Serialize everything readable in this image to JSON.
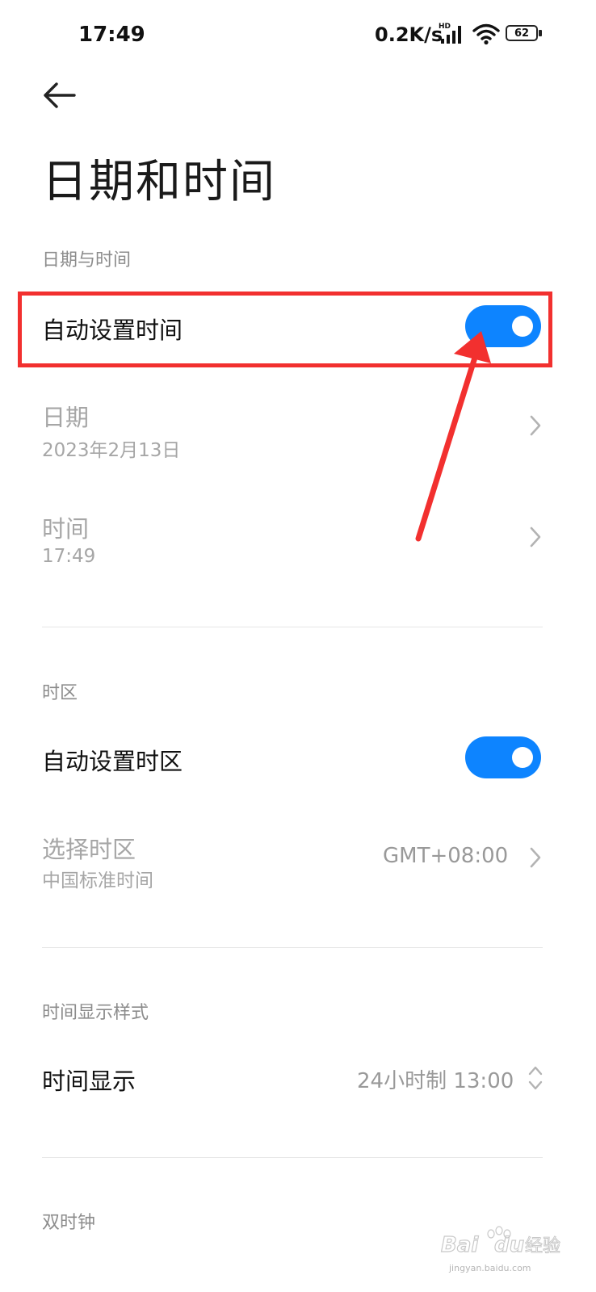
{
  "status_bar": {
    "time": "17:49",
    "network_speed": "0.2K/s",
    "signal_badge": "HD",
    "battery_level": "62",
    "icons": [
      "signal-icon",
      "wifi-icon",
      "battery-icon"
    ]
  },
  "header": {
    "back_icon": "arrow-left-icon",
    "title": "日期和时间"
  },
  "sections": {
    "date_time": {
      "heading": "日期与时间",
      "auto_time": {
        "label": "自动设置时间",
        "enabled": true
      },
      "date": {
        "label": "日期",
        "value": "2023年2月13日"
      },
      "time": {
        "label": "时间",
        "value": "17:49"
      }
    },
    "timezone": {
      "heading": "时区",
      "auto_zone": {
        "label": "自动设置时区",
        "enabled": true
      },
      "select_zone": {
        "label": "选择时区",
        "sub": "中国标准时间",
        "value": "GMT+08:00"
      }
    },
    "time_format": {
      "heading": "时间显示样式",
      "display": {
        "label": "时间显示",
        "value": "24小时制 13:00"
      }
    },
    "dual_clock": {
      "heading": "双时钟"
    }
  },
  "annotation": {
    "highlight_color": "#f2302f"
  },
  "colors": {
    "accent": "#0d84ff"
  },
  "watermark": {
    "brand": "Bai",
    "brand2": "du",
    "cn": "经验",
    "site": "jingyan.baidu.com"
  }
}
